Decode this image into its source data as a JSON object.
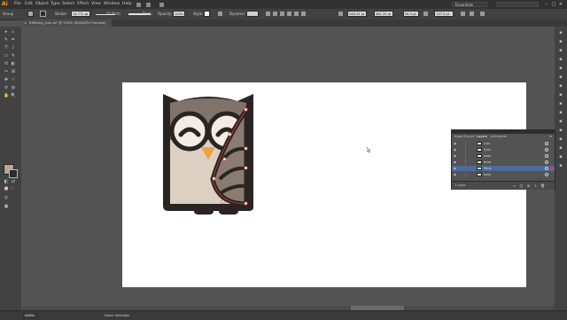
{
  "app": {
    "logo": "Ai"
  },
  "menu": [
    "File",
    "Edit",
    "Object",
    "Type",
    "Select",
    "Effect",
    "View",
    "Window",
    "Help"
  ],
  "workspace": "Essentials",
  "window_buttons": [
    "–",
    "□",
    "✕"
  ],
  "control_bar": {
    "selection_label": "Group",
    "stroke_label": "Stroke:",
    "stroke_value": "14.771 pt",
    "uniform_label": "Uniform",
    "basic_label": "Basic",
    "opacity_label": "Opacity:",
    "opacity_value": "100%",
    "style_label": "Style:",
    "dynamic_label": "Dynamic",
    "x_value": "246.25 pt",
    "y_value": "461.25 pt",
    "w_value": "96.5 pt",
    "h_value": "137.5 pt"
  },
  "document_tab": {
    "title": "Riffbling_icon.ai* @ 150% (RGB/GPU Preview)",
    "close": "×"
  },
  "tools": [
    "▸",
    "▹",
    "✎",
    "✒",
    "T",
    "/",
    "▭",
    "✎",
    "⟲",
    "◐",
    "✂",
    "⊞",
    "✥",
    "☞",
    "⊘",
    "◍",
    "✋",
    "🔍"
  ],
  "tool_names": [
    "selection-tool-icon",
    "direct-selection-tool-icon",
    "magic-wand-tool-icon",
    "pen-tool-icon",
    "type-tool-icon",
    "line-tool-icon",
    "rectangle-tool-icon",
    "paintbrush-tool-icon",
    "rotate-tool-icon",
    "width-tool-icon",
    "scissors-tool-icon",
    "shape-builder-tool-icon",
    "free-transform-tool-icon",
    "symbol-sprayer-tool-icon",
    "eyedropper-tool-icon",
    "blend-tool-icon",
    "hand-tool-icon",
    "zoom-tool-icon"
  ],
  "dock_icons": [
    "color-panel-icon",
    "swatches-panel-icon",
    "brushes-panel-icon",
    "symbols-panel-icon",
    "stroke-panel-icon",
    "gradient-panel-icon",
    "transparency-panel-icon",
    "appearance-panel-icon",
    "graphic-styles-panel-icon",
    "layers-panel-icon",
    "artboards-panel-icon",
    "links-panel-icon",
    "align-panel-icon",
    "transform-panel-icon",
    "pathfinder-panel-icon",
    "type-panel-icon"
  ],
  "layers_panel": {
    "tabs": [
      "Asset Export",
      "Layers",
      "Artboards"
    ],
    "active_tab": "Layers",
    "rows": [
      {
        "name": "icon",
        "indent": 0
      },
      {
        "name": "Eyes",
        "indent": 1
      },
      {
        "name": "beak",
        "indent": 1
      },
      {
        "name": "brow",
        "indent": 1
      },
      {
        "name": "Wing",
        "indent": 1,
        "selected": true
      },
      {
        "name": "body",
        "indent": 1
      }
    ],
    "layer_count": "1 Layer"
  },
  "status": {
    "zoom": "150%",
    "tool": "Direct Selection"
  },
  "colors": {
    "owl_outline": "#2a2522",
    "owl_head": "#7f736b",
    "owl_face": "#f2ece5",
    "owl_body": "#dcd0c3",
    "owl_wing": "#8a7c72",
    "owl_beak": "#f2a13b",
    "selection": "#d93d3d",
    "ai_orange": "#ff9a00"
  }
}
